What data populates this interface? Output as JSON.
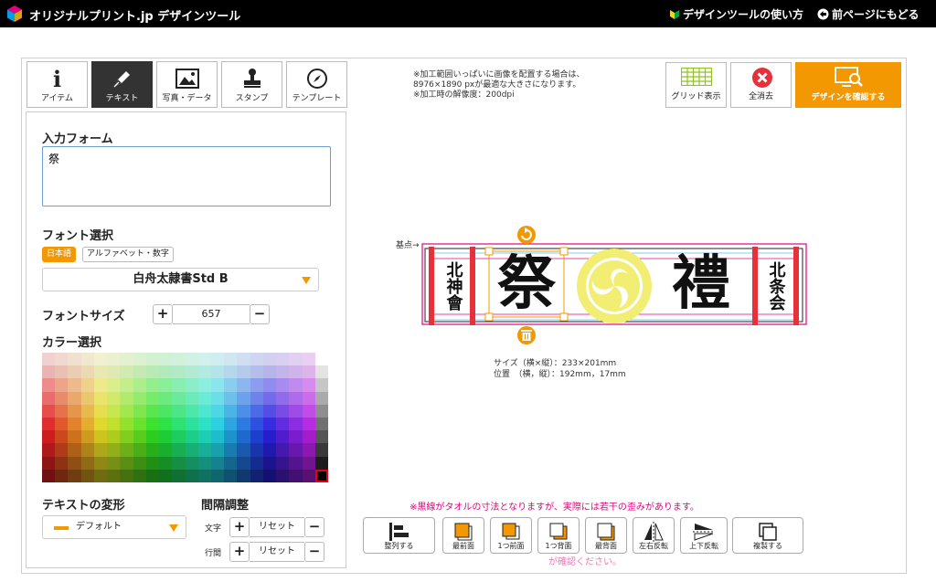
{
  "header": {
    "app_title": "オリジナルプリント.jp デザインツール",
    "how_to_link": "デザインツールの使い方",
    "back_link": "前ページにもどる"
  },
  "tabs": [
    {
      "label": "アイテム",
      "icon": "info-icon"
    },
    {
      "label": "テキスト",
      "icon": "pen-icon",
      "active": true
    },
    {
      "label": "写真・データ",
      "icon": "image-icon"
    },
    {
      "label": "スタンプ",
      "icon": "stamp-icon"
    },
    {
      "label": "テンプレート",
      "icon": "compass-icon"
    }
  ],
  "text_panel": {
    "input_title": "入力フォーム",
    "input_value": "祭",
    "font_title": "フォント選択",
    "font_tab_japanese": "日本語",
    "font_tab_alphanumeric": "アルファベット・数字",
    "font_name": "白舟太隷書Std B",
    "size_title": "フォントサイズ",
    "size_value": "657",
    "color_title": "カラー選択",
    "transform_title": "テキストの変形",
    "transform_value": "デフォルト",
    "spacing_title": "間隔調整",
    "char_label": "文字",
    "line_label": "行間",
    "reset_label": "リセット",
    "plus": "+",
    "minus": "−"
  },
  "notes": [
    "※加工範囲いっぱいに画像を配置する場合は、",
    "8976×1890 pxが最適な大きさになります。",
    "※加工時の解像度：200dpi"
  ],
  "toolbar": {
    "grid_label": "グリッド表示",
    "clear_label": "全消去",
    "confirm_label": "デザインを確認する"
  },
  "canvas": {
    "origin_label": "基点→",
    "main_char_1": "祭",
    "main_char_2": "禮",
    "side_text_left": "北神會",
    "side_text_right": "北条会",
    "size_line": "サイズ（横×縦）：233×201mm",
    "position_line": "位置　（横，縦）：192mm，17mm"
  },
  "warning": "※黒線がタオルの寸法となりますが、実際には若干の歪みがあります。",
  "warning_hidden": "が確認ください。",
  "bottom_tools": [
    {
      "label": "整列する",
      "icon": "align-icon"
    },
    {
      "label": "最前面",
      "icon": "bring-to-front-icon"
    },
    {
      "label": "1つ前面",
      "icon": "bring-forward-icon"
    },
    {
      "label": "1つ背面",
      "icon": "send-backward-icon"
    },
    {
      "label": "最背面",
      "icon": "send-to-back-icon"
    },
    {
      "label": "左右反転",
      "icon": "flip-horizontal-icon"
    },
    {
      "label": "上下反転",
      "icon": "flip-vertical-icon"
    },
    {
      "label": "複製する",
      "icon": "duplicate-icon"
    }
  ],
  "colors": {
    "accent": "#f39800",
    "header_bg": "#000000",
    "warning": "#e4007f",
    "clear_red": "#e8303a",
    "selected_swatch": "#e60012"
  }
}
